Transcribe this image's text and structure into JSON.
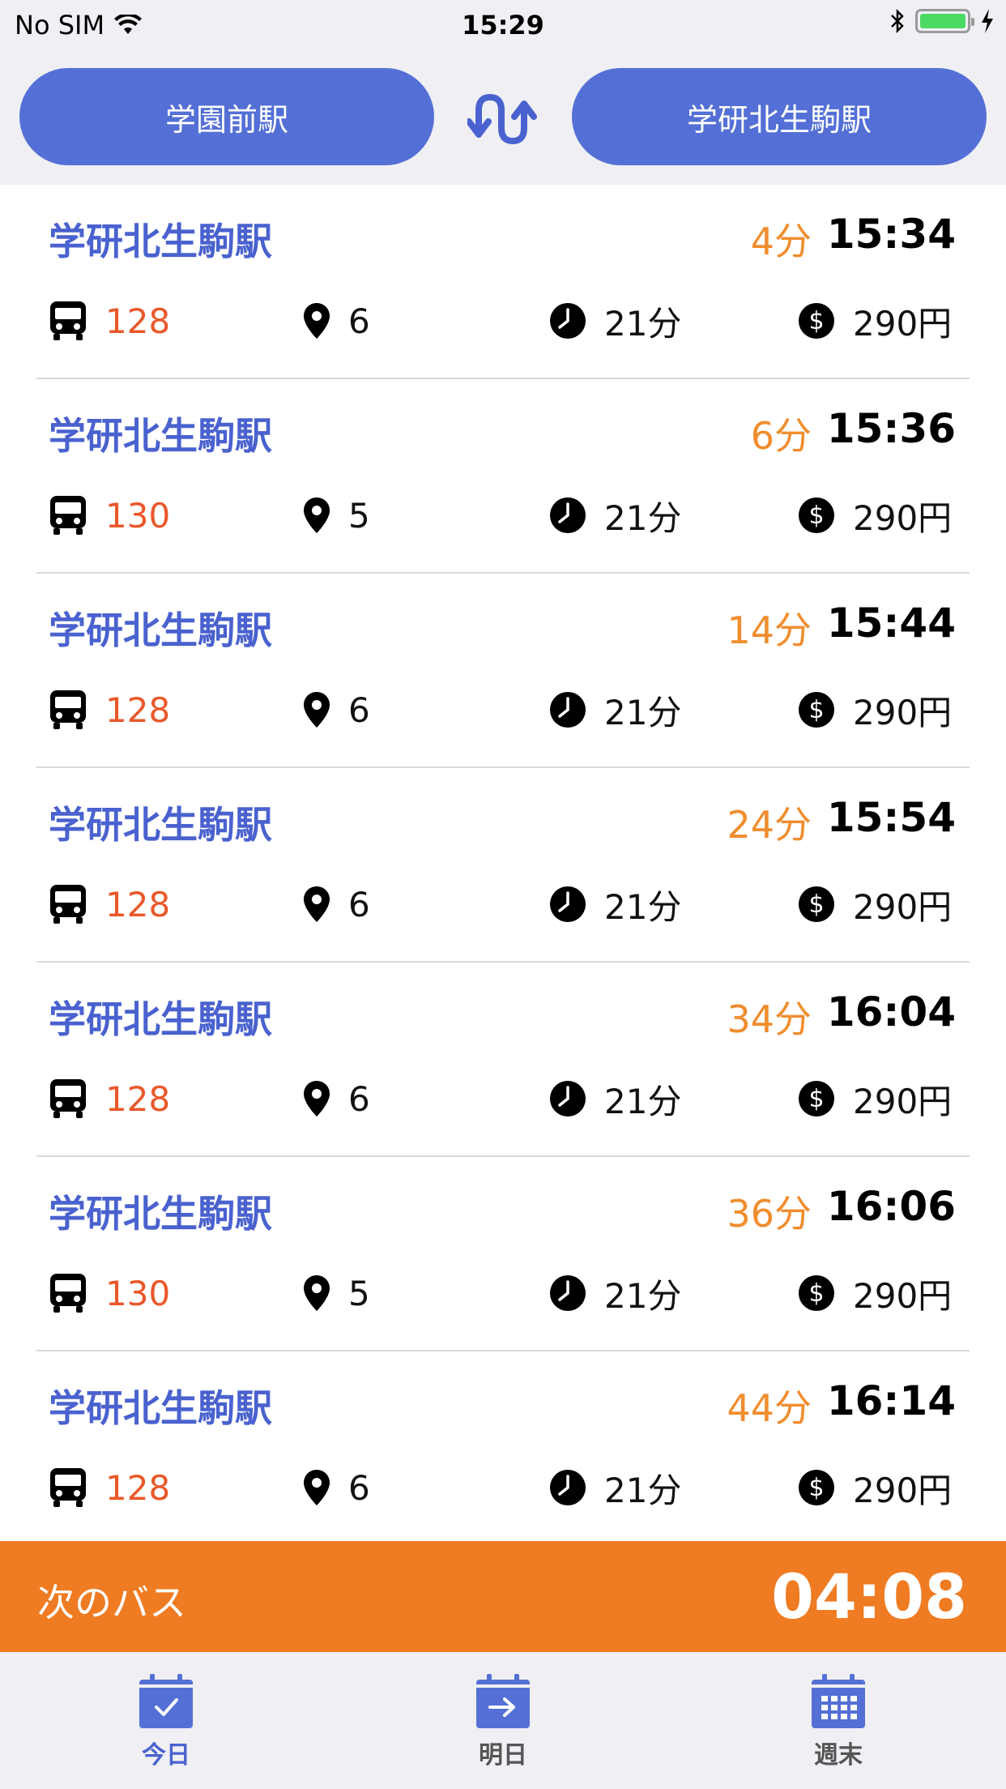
{
  "status_bar": {
    "carrier": "No SIM",
    "time": "15:29",
    "accent": "#4cd964"
  },
  "header": {
    "from_station": "学園前駅",
    "to_station": "学研北生駒駅",
    "swap_icon": "swap-arrows-icon",
    "accent": "#5470d6"
  },
  "departures": [
    {
      "destination": "学研北生駒駅",
      "wait": "4分",
      "time": "15:34",
      "bus": "128",
      "stop": "6",
      "duration": "21分",
      "fare": "290円"
    },
    {
      "destination": "学研北生駒駅",
      "wait": "6分",
      "time": "15:36",
      "bus": "130",
      "stop": "5",
      "duration": "21分",
      "fare": "290円"
    },
    {
      "destination": "学研北生駒駅",
      "wait": "14分",
      "time": "15:44",
      "bus": "128",
      "stop": "6",
      "duration": "21分",
      "fare": "290円"
    },
    {
      "destination": "学研北生駒駅",
      "wait": "24分",
      "time": "15:54",
      "bus": "128",
      "stop": "6",
      "duration": "21分",
      "fare": "290円"
    },
    {
      "destination": "学研北生駒駅",
      "wait": "34分",
      "time": "16:04",
      "bus": "128",
      "stop": "6",
      "duration": "21分",
      "fare": "290円"
    },
    {
      "destination": "学研北生駒駅",
      "wait": "36分",
      "time": "16:06",
      "bus": "130",
      "stop": "5",
      "duration": "21分",
      "fare": "290円"
    },
    {
      "destination": "学研北生駒駅",
      "wait": "44分",
      "time": "16:14",
      "bus": "128",
      "stop": "6",
      "duration": "21分",
      "fare": "290円"
    }
  ],
  "next_bus": {
    "label": "次のバス",
    "countdown": "04:08",
    "color": "#ef7b22"
  },
  "tabs": [
    {
      "label": "今日",
      "icon": "calendar-check-icon"
    },
    {
      "label": "明日",
      "icon": "calendar-arrow-icon"
    },
    {
      "label": "週末",
      "icon": "calendar-grid-icon"
    }
  ]
}
